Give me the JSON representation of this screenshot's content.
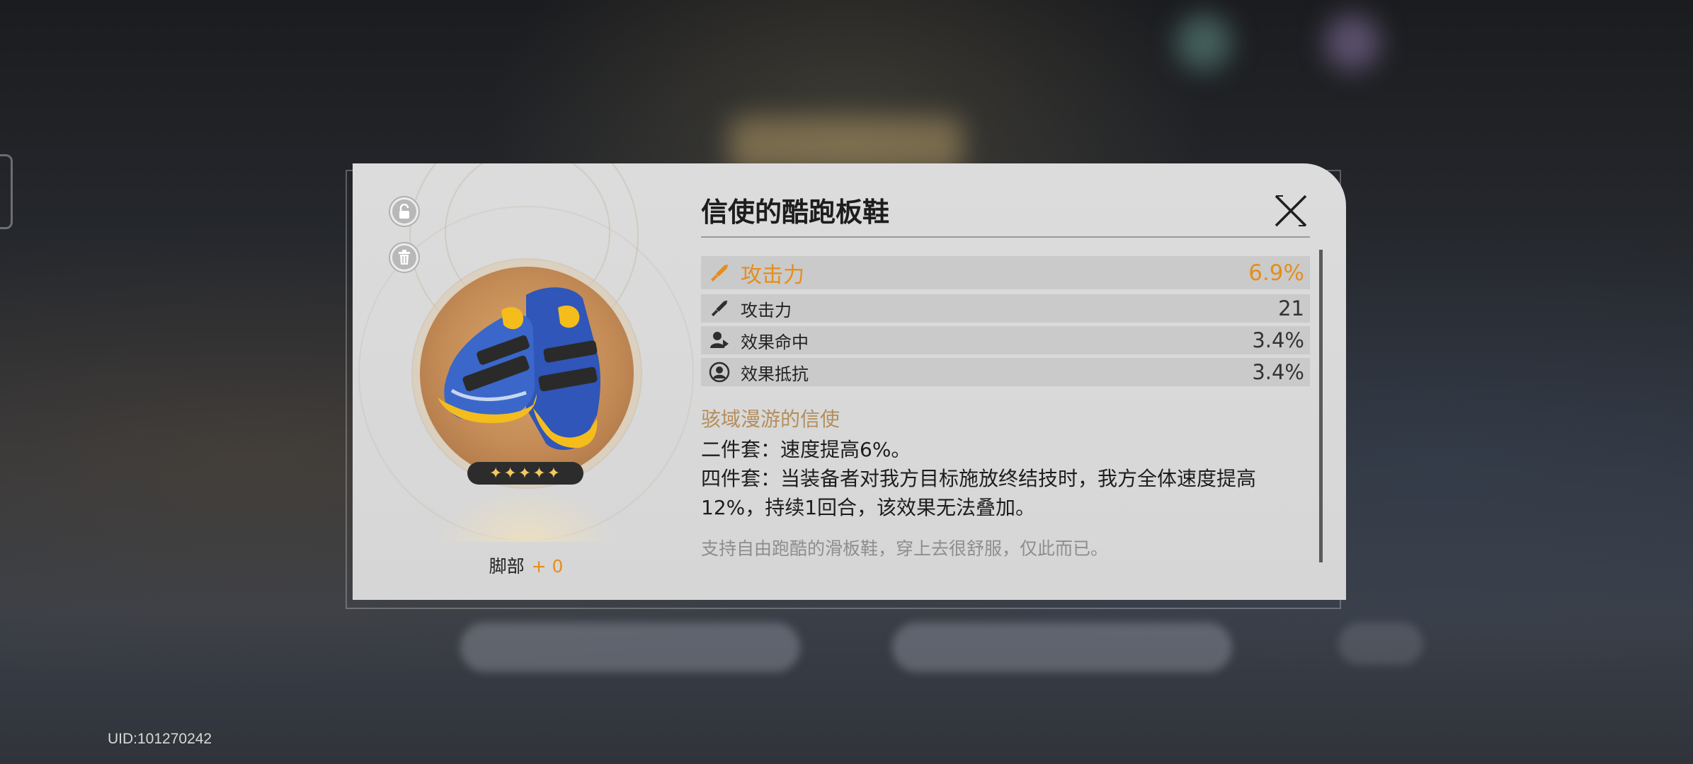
{
  "item": {
    "name": "信使的酷跑板鞋",
    "rarity_stars": "✦✦✦✦✦",
    "slot_label": "脚部",
    "level": "+ 0"
  },
  "main_stat": {
    "name": "攻击力",
    "value": "6.9%",
    "icon": "sword-icon"
  },
  "sub_stats": [
    {
      "name": "攻击力",
      "value": "21",
      "icon": "sword-icon"
    },
    {
      "name": "效果命中",
      "value": "3.4%",
      "icon": "effect-hit-icon"
    },
    {
      "name": "效果抵抗",
      "value": "3.4%",
      "icon": "effect-res-icon"
    }
  ],
  "set": {
    "name": "骇域漫游的信使",
    "two_piece": "二件套：速度提高6%。",
    "four_piece": "四件套：当装备者对我方目标施放终结技时，我方全体速度提高12%，持续1回合，该效果无法叠加。"
  },
  "flavor": "支持自由跑酷的滑板鞋，穿上去很舒服，仅此而已。",
  "uid": "UID:101270242",
  "colors": {
    "accent": "#e48e1d",
    "set_name": "#b48e5c",
    "panel": "#d8d8d8"
  }
}
